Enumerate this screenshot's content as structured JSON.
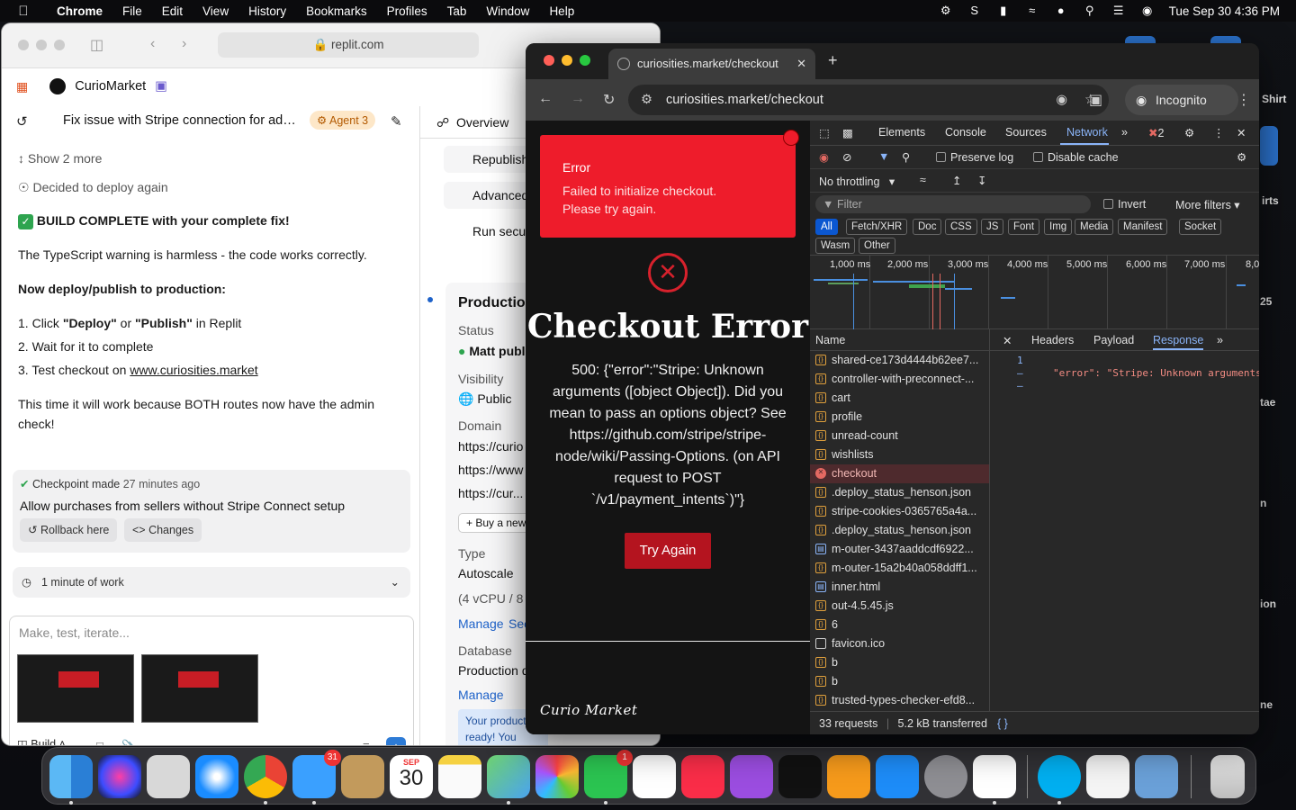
{
  "menubar": {
    "app": "Chrome",
    "items": [
      "File",
      "Edit",
      "View",
      "History",
      "Bookmarks",
      "Profiles",
      "Tab",
      "Window",
      "Help"
    ],
    "clock": "Tue Sep 30  4:36 PM"
  },
  "desktop": {
    "labels": [
      "Shirt",
      "irts",
      "25",
      "tae",
      "n",
      "ion",
      "ne"
    ]
  },
  "replit": {
    "url": "replit.com",
    "project": "CurioMarket",
    "task_title": "Fix issue with Stripe connection for admi...",
    "agent_badge": "Agent 3",
    "show_more": "Show 2 more",
    "decided": "Decided to deploy again",
    "build_complete": "BUILD COMPLETE with your complete fix!",
    "ts_warning": "The TypeScript warning is harmless - the code works correctly.",
    "deploy_heading": "Now deploy/publish to production:",
    "steps": [
      {
        "num": "1.",
        "pre": "Click ",
        "b1": "\"Deploy\"",
        "mid": " or ",
        "b2": "\"Publish\"",
        "post": " in Replit"
      },
      {
        "num": "2.",
        "text": "Wait for it to complete"
      },
      {
        "num": "3.",
        "pre": "Test checkout on ",
        "link": "www.curiosities.market"
      }
    ],
    "this_time": "This time it will work because BOTH routes now have the admin check!",
    "checkpoint": {
      "label": "Checkpoint made",
      "time": "27 minutes ago",
      "message": "Allow purchases from sellers without Stripe Connect setup",
      "rollback": "Rollback here",
      "changes": "Changes"
    },
    "work_time": "1 minute of work",
    "composer_placeholder": "Make, test, iterate...",
    "build_label": "Build",
    "right_panel": {
      "overview_tab": "Overview",
      "republish": "Republish",
      "advanced": "Advanced",
      "run_security": "Run secu",
      "production": "Production",
      "status_label": "Status",
      "status_value": "Matt publ",
      "visibility_label": "Visibility",
      "visibility_value": "Public",
      "domain_label": "Domain",
      "domains": [
        "https://curio",
        "https://www",
        "https://cur..."
      ],
      "buy_new": "+ Buy a new",
      "type_label": "Type",
      "type_value": "Autoscale",
      "specs": "(4 vCPU / 8 G",
      "manage": "Manage",
      "see": "See",
      "database_label": "Database",
      "database_value": "Production d",
      "db_manage": "Manage",
      "note": "Your product is ready! You save and ma"
    }
  },
  "browser": {
    "tab_title": "curiosities.market/checkout",
    "url": "curiosities.market/checkout",
    "incognito": "Incognito",
    "toast": {
      "title": "Error",
      "message": "Failed to initialize checkout. Please try again."
    },
    "page_title": "Checkout Error",
    "error_message": "500: {\"error\":\"Stripe: Unknown arguments ([object Object]). Did you mean to pass an options object? See https://github.com/stripe/stripe-node/wiki/Passing-Options. (on API request to POST `/v1/payment_intents`)\"}",
    "try_again": "Try Again",
    "brand": "Curio Market"
  },
  "devtools": {
    "tabs": [
      "Elements",
      "Console",
      "Sources",
      "Network"
    ],
    "error_count": "2",
    "preserve_log": "Preserve log",
    "disable_cache": "Disable cache",
    "throttling": "No throttling",
    "filter_placeholder": "Filter",
    "invert": "Invert",
    "more_filters": "More filters",
    "types": [
      "All",
      "Fetch/XHR",
      "Doc",
      "CSS",
      "JS",
      "Font",
      "Img",
      "Media",
      "Manifest",
      "Socket",
      "Wasm",
      "Other"
    ],
    "timeline_labels": [
      "1,000 ms",
      "2,000 ms",
      "3,000 ms",
      "4,000 ms",
      "5,000 ms",
      "6,000 ms",
      "7,000 ms",
      "8,0"
    ],
    "name_header": "Name",
    "requests": [
      {
        "name": "shared-ce173d4444b62ee7...",
        "kind": "script"
      },
      {
        "name": "controller-with-preconnect-...",
        "kind": "script"
      },
      {
        "name": "cart",
        "kind": "script"
      },
      {
        "name": "profile",
        "kind": "script"
      },
      {
        "name": "unread-count",
        "kind": "script"
      },
      {
        "name": "wishlists",
        "kind": "script"
      },
      {
        "name": "checkout",
        "kind": "error"
      },
      {
        "name": ".deploy_status_henson.json",
        "kind": "script"
      },
      {
        "name": "stripe-cookies-0365765a4a...",
        "kind": "script"
      },
      {
        "name": ".deploy_status_henson.json",
        "kind": "script"
      },
      {
        "name": "m-outer-3437aaddcdf6922...",
        "kind": "doc"
      },
      {
        "name": "m-outer-15a2b40a058ddff1...",
        "kind": "script"
      },
      {
        "name": "inner.html",
        "kind": "doc"
      },
      {
        "name": "out-4.5.45.js",
        "kind": "script"
      },
      {
        "name": "6",
        "kind": "script"
      },
      {
        "name": "favicon.ico",
        "kind": "img"
      },
      {
        "name": "b",
        "kind": "script"
      },
      {
        "name": "b",
        "kind": "script"
      },
      {
        "name": "trusted-types-checker-efd8...",
        "kind": "script"
      }
    ],
    "detail_tabs": [
      "Headers",
      "Payload",
      "Response"
    ],
    "response_line_no": "1",
    "response_text": "\"error\": \"Stripe: Unknown arguments",
    "summary_requests": "33 requests",
    "summary_transferred": "5.2 kB transferred"
  },
  "dock": {
    "calendar_month": "SEP",
    "calendar_day": "30",
    "mail_badge": "31",
    "facetime_badge": "1"
  }
}
